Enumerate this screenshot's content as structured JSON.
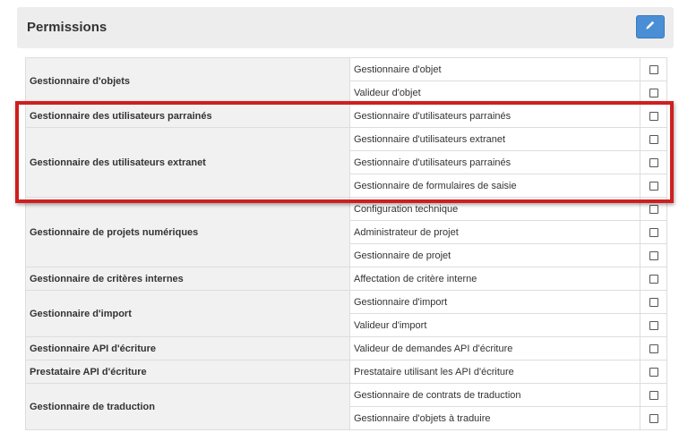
{
  "panel": {
    "title": "Permissions",
    "edit_icon": "pencil-icon"
  },
  "groups": [
    {
      "name": "Gestionnaire d'objets",
      "roles": [
        "Gestionnaire d'objet",
        "Valideur d'objet"
      ]
    },
    {
      "name": "Gestionnaire des utilisateurs parrainés",
      "roles": [
        "Gestionnaire d'utilisateurs parrainés"
      ]
    },
    {
      "name": "Gestionnaire des utilisateurs extranet",
      "roles": [
        "Gestionnaire d'utilisateurs extranet",
        "Gestionnaire d'utilisateurs parrainés",
        "Gestionnaire de formulaires de saisie"
      ]
    },
    {
      "name": "Gestionnaire de projets numériques",
      "roles": [
        "Configuration technique",
        "Administrateur de projet",
        "Gestionnaire de projet"
      ]
    },
    {
      "name": "Gestionnaire de critères internes",
      "roles": [
        "Affectation de critère interne"
      ]
    },
    {
      "name": "Gestionnaire d'import",
      "roles": [
        "Gestionnaire d'import",
        "Valideur d'import"
      ]
    },
    {
      "name": "Gestionnaire API d'écriture",
      "roles": [
        "Valideur de demandes API d'écriture"
      ]
    },
    {
      "name": "Prestataire API d'écriture",
      "roles": [
        "Prestataire utilisant les API d'écriture"
      ]
    },
    {
      "name": "Gestionnaire de traduction",
      "roles": [
        "Gestionnaire de contrats de traduction",
        "Gestionnaire d'objets à traduire"
      ]
    }
  ],
  "colors": {
    "accent": "#4a8fd6",
    "highlight": "#d01e1e"
  }
}
